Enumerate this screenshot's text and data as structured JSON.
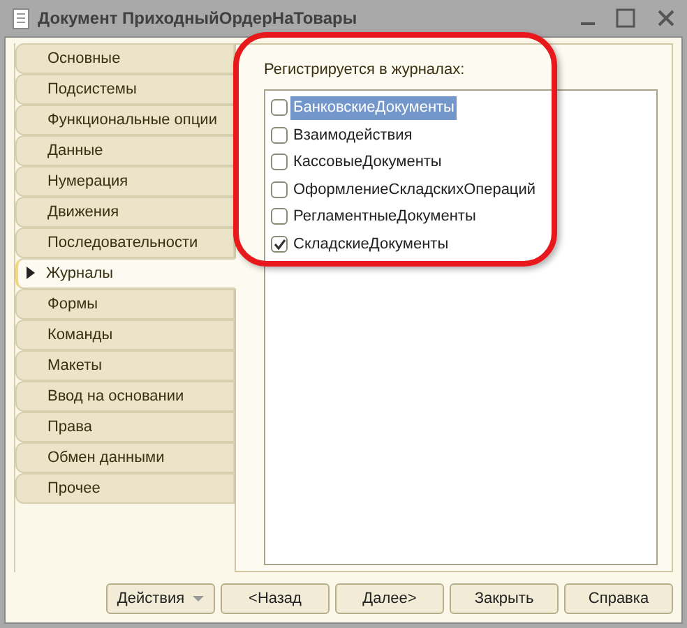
{
  "window": {
    "title": "Документ ПриходныйОрдерНаТовары"
  },
  "tabs": [
    {
      "label": "Основные",
      "selected": false
    },
    {
      "label": "Подсистемы",
      "selected": false
    },
    {
      "label": "Функциональные опции",
      "selected": false
    },
    {
      "label": "Данные",
      "selected": false
    },
    {
      "label": "Нумерация",
      "selected": false
    },
    {
      "label": "Движения",
      "selected": false
    },
    {
      "label": "Последовательности",
      "selected": false
    },
    {
      "label": "Журналы",
      "selected": true
    },
    {
      "label": "Формы",
      "selected": false
    },
    {
      "label": "Команды",
      "selected": false
    },
    {
      "label": "Макеты",
      "selected": false
    },
    {
      "label": "Ввод на основании",
      "selected": false
    },
    {
      "label": "Права",
      "selected": false
    },
    {
      "label": "Обмен данными",
      "selected": false
    },
    {
      "label": "Прочее",
      "selected": false
    }
  ],
  "journals": {
    "label": "Регистрируется в журналах:",
    "items": [
      {
        "name": "БанковскиеДокументы",
        "checked": false,
        "selected": true
      },
      {
        "name": "Взаимодействия",
        "checked": false,
        "selected": false
      },
      {
        "name": "КассовыеДокументы",
        "checked": false,
        "selected": false
      },
      {
        "name": "ОформлениеСкладскихОпераций",
        "checked": false,
        "selected": false
      },
      {
        "name": "РегламентныеДокументы",
        "checked": false,
        "selected": false
      },
      {
        "name": "СкладскиеДокументы",
        "checked": true,
        "selected": false
      }
    ]
  },
  "buttons": [
    {
      "label": "Действия",
      "kind": "dropdown"
    },
    {
      "label": "<Назад",
      "kind": "plain"
    },
    {
      "label": "Далее>",
      "kind": "plain"
    },
    {
      "label": "Закрыть",
      "kind": "plain"
    },
    {
      "label": "Справка",
      "kind": "plain"
    }
  ]
}
